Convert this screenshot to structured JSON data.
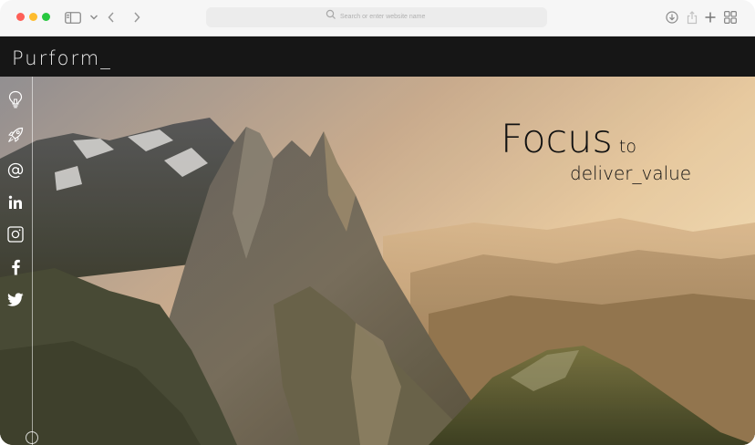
{
  "browser": {
    "address_placeholder": "Search or enter website name",
    "icons": [
      "sidebar-icon",
      "chevron-down-icon",
      "back-icon",
      "forward-icon",
      "search-icon",
      "download-icon",
      "share-icon",
      "new-tab-icon",
      "tab-overview-icon"
    ]
  },
  "site": {
    "logo": "Purform_",
    "headline_main": "Focus",
    "headline_small": "to",
    "headline_sub": "deliver_value"
  },
  "social": {
    "items": [
      "idea-icon",
      "rocket-icon",
      "at-icon",
      "linkedin-icon",
      "instagram-icon",
      "facebook-icon",
      "twitter-icon"
    ]
  },
  "colors": {
    "topbar": "#161616",
    "traffic_red": "#fe5f57",
    "traffic_yellow": "#febc2e",
    "traffic_green": "#28c840"
  }
}
